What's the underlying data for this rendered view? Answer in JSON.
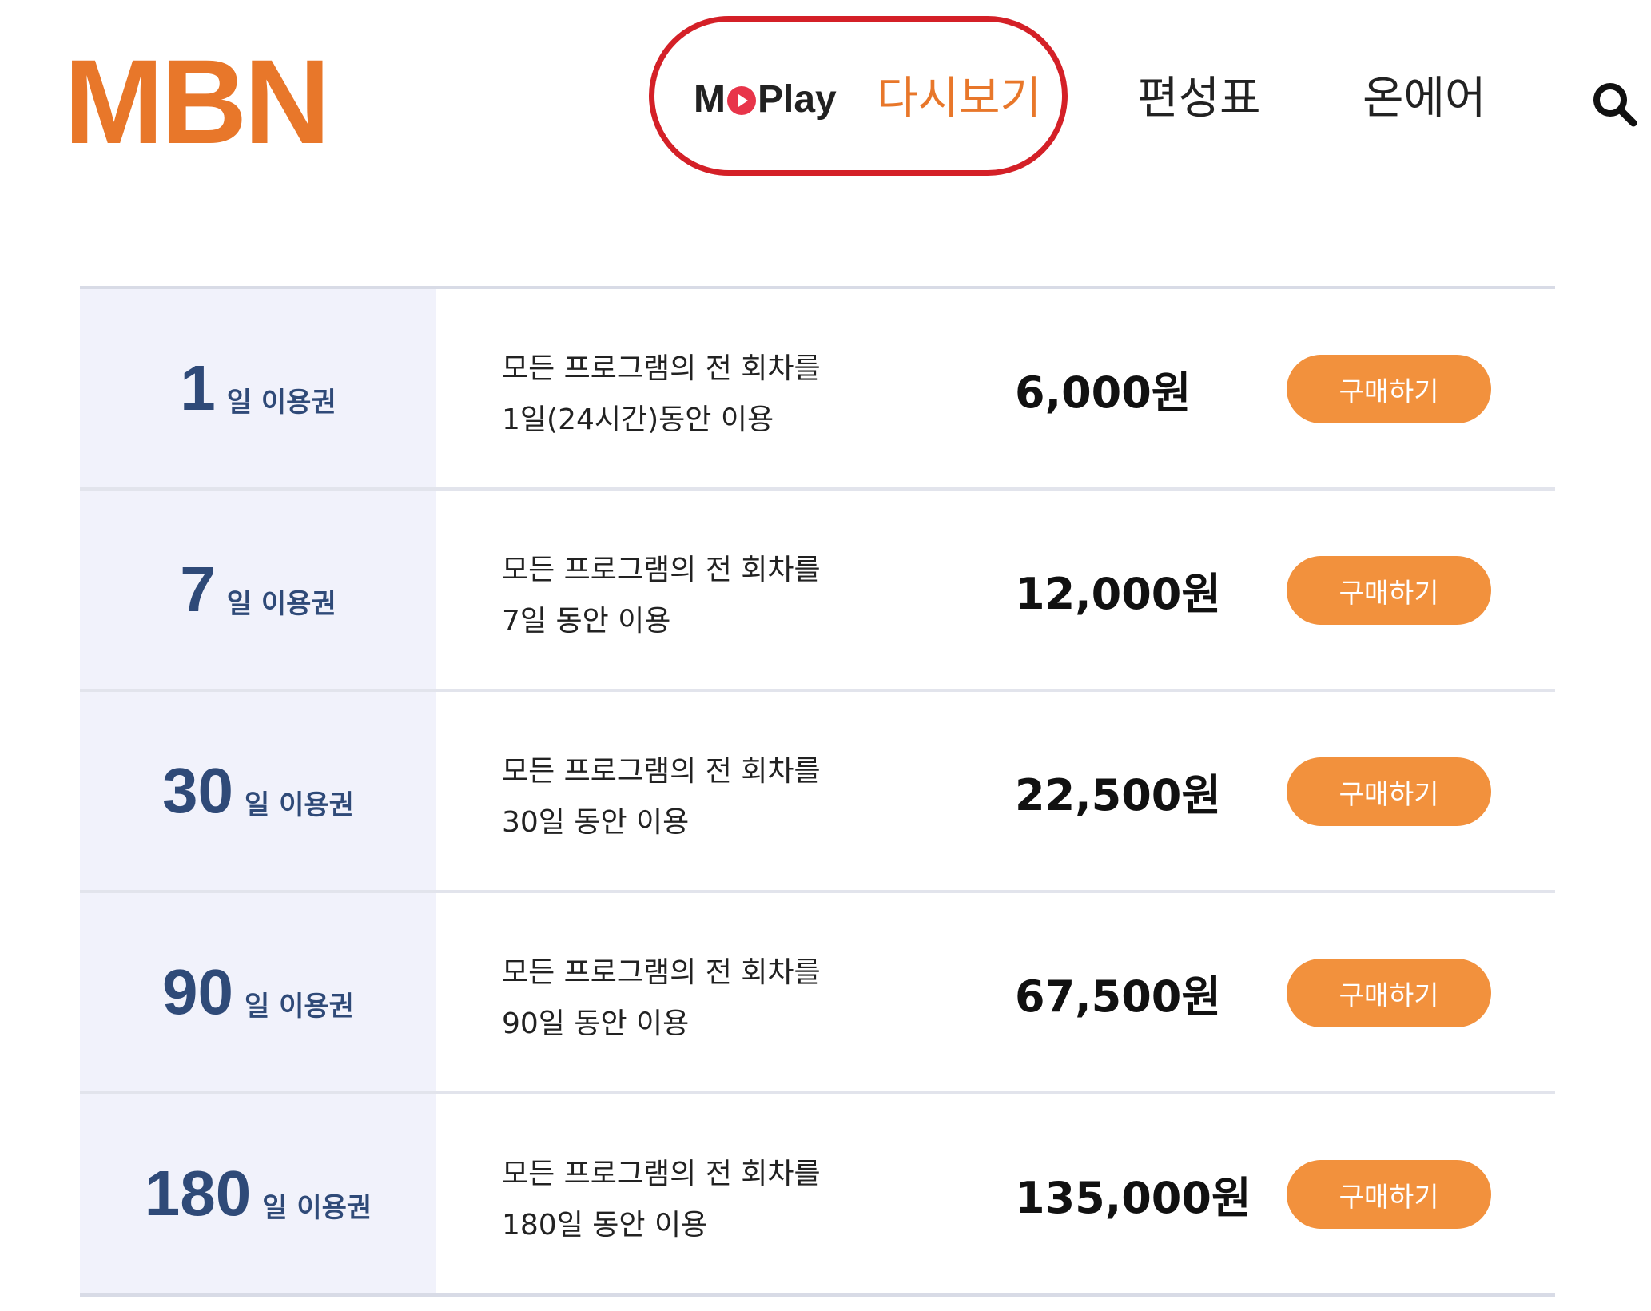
{
  "header": {
    "logo": "MBN",
    "brand_left": "M",
    "brand_right": "Play",
    "nav": {
      "vod": "다시보기",
      "schedule": "편성표",
      "onair": "온에어"
    },
    "search_icon": "search-icon"
  },
  "plans": [
    {
      "number": "1",
      "suffix": "일 이용권",
      "desc_line1": "모든 프로그램의 전 회차를",
      "desc_line2": "1일(24시간)동안 이용",
      "price": "6,000원",
      "button": "구매하기"
    },
    {
      "number": "7",
      "suffix": "일 이용권",
      "desc_line1": "모든 프로그램의 전 회차를",
      "desc_line2": "7일 동안 이용",
      "price": "12,000원",
      "button": "구매하기"
    },
    {
      "number": "30",
      "suffix": "일 이용권",
      "desc_line1": "모든 프로그램의 전 회차를",
      "desc_line2": "30일 동안 이용",
      "price": "22,500원",
      "button": "구매하기"
    },
    {
      "number": "90",
      "suffix": "일 이용권",
      "desc_line1": "모든 프로그램의 전 회차를",
      "desc_line2": "90일 동안 이용",
      "price": "67,500원",
      "button": "구매하기"
    },
    {
      "number": "180",
      "suffix": "일 이용권",
      "desc_line1": "모든 프로그램의 전 회차를",
      "desc_line2": "180일 동안 이용",
      "price": "135,000원",
      "button": "구매하기"
    }
  ],
  "colors": {
    "brand_orange": "#e8772a",
    "button_orange": "#f2913d",
    "highlight_red": "#d42027",
    "plan_navy": "#2f4a78"
  }
}
